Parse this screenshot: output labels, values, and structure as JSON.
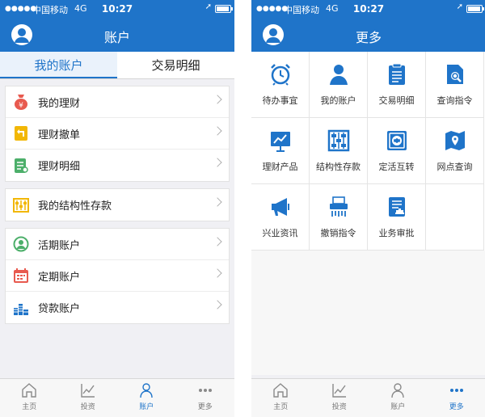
{
  "left": {
    "status": {
      "dots": "●●●●●",
      "carrier": "中国移动",
      "net": "4G",
      "time": "10:27"
    },
    "title": "账户",
    "tabs": [
      {
        "label": "我的账户"
      },
      {
        "label": "交易明细"
      }
    ],
    "groups": [
      [
        {
          "label": "我的理财",
          "icon": "money-bag-icon"
        },
        {
          "label": "理财撤单",
          "icon": "undo-icon"
        },
        {
          "label": "理财明细",
          "icon": "document-icon"
        }
      ],
      [
        {
          "label": "我的结构性存款",
          "icon": "abacus-icon"
        }
      ],
      [
        {
          "label": "活期账户",
          "icon": "person-circle-icon"
        },
        {
          "label": "定期账户",
          "icon": "calendar-icon"
        },
        {
          "label": "贷款账户",
          "icon": "coins-icon"
        }
      ]
    ],
    "tabbar": [
      {
        "label": "主页",
        "icon": "home-icon"
      },
      {
        "label": "投资",
        "icon": "chart-icon"
      },
      {
        "label": "账户",
        "icon": "user-icon"
      },
      {
        "label": "更多",
        "icon": "more-icon"
      }
    ]
  },
  "right": {
    "status": {
      "dots": "●●●●●",
      "carrier": "中国移动",
      "net": "4G",
      "time": "10:27"
    },
    "title": "更多",
    "grid": [
      {
        "label": "待办事宜",
        "icon": "alarm-clock-icon"
      },
      {
        "label": "我的账户",
        "icon": "user-icon"
      },
      {
        "label": "交易明细",
        "icon": "list-icon"
      },
      {
        "label": "查询指令",
        "icon": "search-document-icon"
      },
      {
        "label": "理财产品",
        "icon": "presentation-icon"
      },
      {
        "label": "结构性存款",
        "icon": "abacus-icon"
      },
      {
        "label": "定活互转",
        "icon": "safe-icon"
      },
      {
        "label": "网点查询",
        "icon": "map-icon"
      },
      {
        "label": "兴业资讯",
        "icon": "megaphone-icon"
      },
      {
        "label": "撤销指令",
        "icon": "shredder-icon"
      },
      {
        "label": "业务审批",
        "icon": "approval-icon"
      }
    ],
    "tabbar": [
      {
        "label": "主页",
        "icon": "home-icon"
      },
      {
        "label": "投资",
        "icon": "chart-icon"
      },
      {
        "label": "账户",
        "icon": "user-icon"
      },
      {
        "label": "更多",
        "icon": "more-icon"
      }
    ]
  },
  "colors": {
    "brand": "#1f74c9"
  }
}
